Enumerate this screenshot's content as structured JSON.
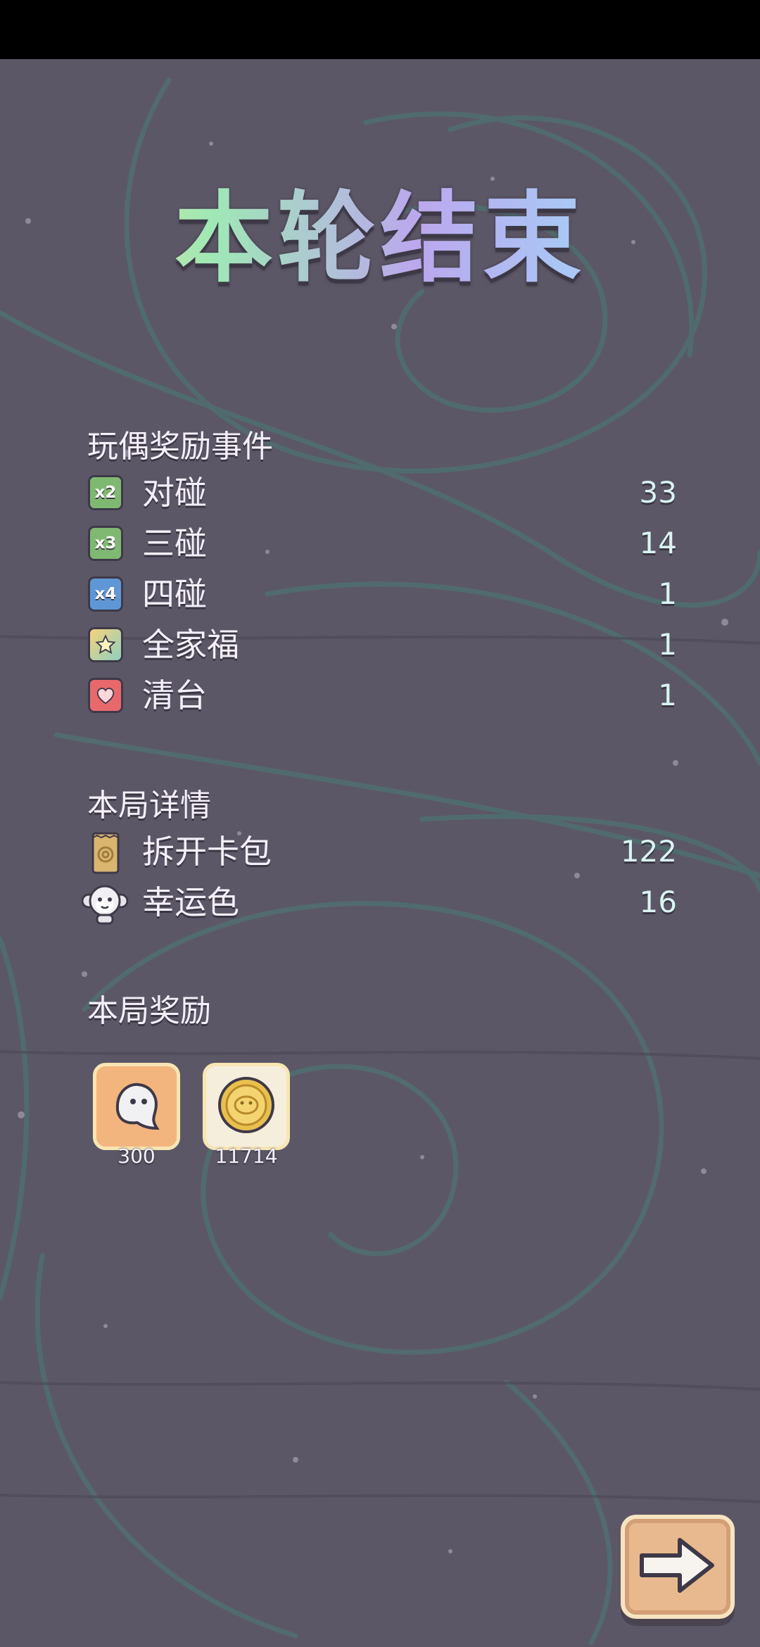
{
  "title": "本轮结束",
  "doll_events": {
    "heading": "玩偶奖励事件",
    "items": [
      {
        "label": "对碰",
        "value": "33",
        "icon": "x2-badge-icon",
        "badge": "x2"
      },
      {
        "label": "三碰",
        "value": "14",
        "icon": "x3-badge-icon",
        "badge": "x3"
      },
      {
        "label": "四碰",
        "value": "1",
        "icon": "x4-badge-icon",
        "badge": "x4"
      },
      {
        "label": "全家福",
        "value": "1",
        "icon": "star-badge-icon"
      },
      {
        "label": "清台",
        "value": "1",
        "icon": "heart-badge-icon"
      }
    ]
  },
  "round_details": {
    "heading": "本局详情",
    "items": [
      {
        "label": "拆开卡包",
        "value": "122",
        "icon": "card-pack-icon"
      },
      {
        "label": "幸运色",
        "value": "16",
        "icon": "monkey-icon"
      }
    ]
  },
  "round_rewards": {
    "heading": "本局奖励",
    "items": [
      {
        "count": "300",
        "icon": "ghost-token-icon"
      },
      {
        "count": "11714",
        "icon": "gold-coin-icon"
      }
    ]
  },
  "colors": {
    "background": "#5c5766",
    "swirl": "#4f6f70",
    "text": "#f4eff8",
    "value_text": "#d9f4f2"
  }
}
